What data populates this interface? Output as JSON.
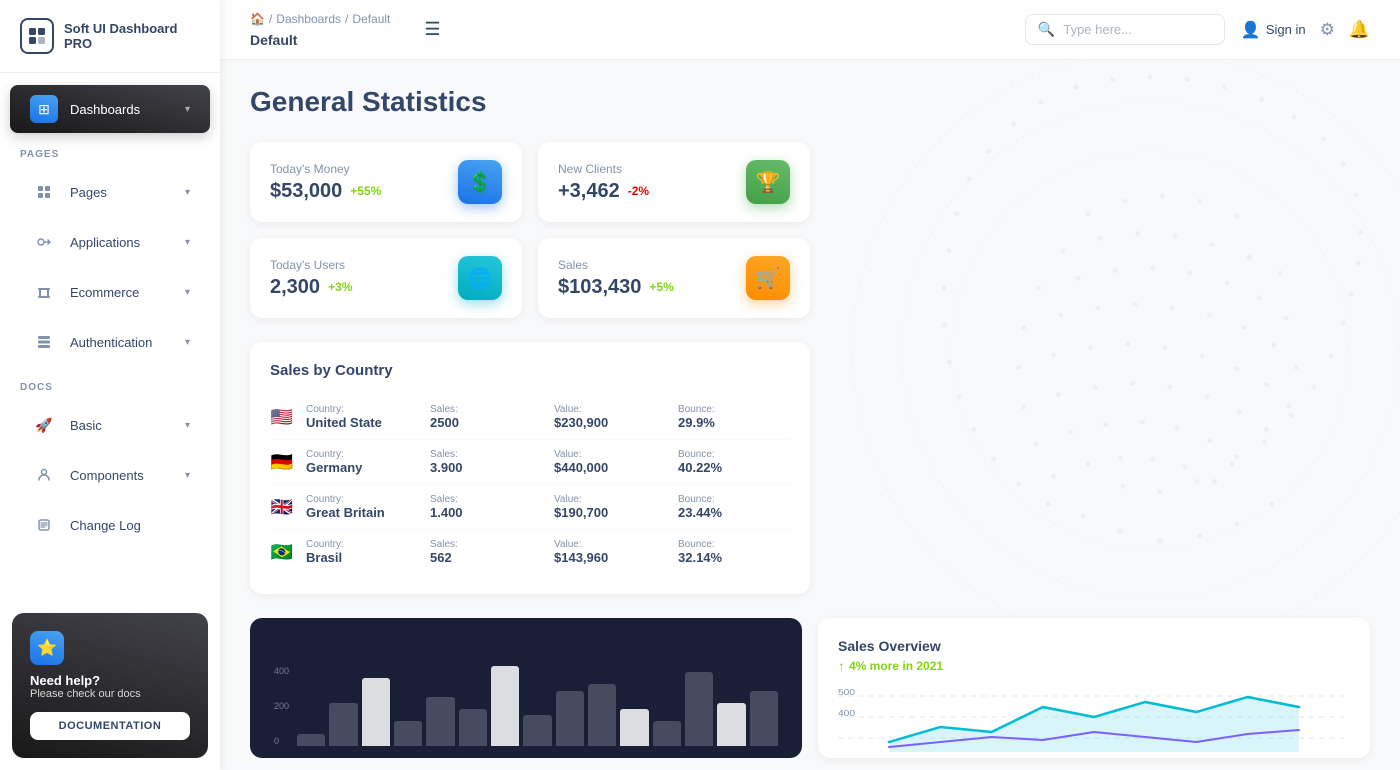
{
  "app": {
    "title": "Soft UI Dashboard PRO"
  },
  "sidebar": {
    "logo_text": "Soft UI Dashboard PRO",
    "active_item": "Dashboards",
    "sections": [
      {
        "label": "PAGES",
        "items": [
          {
            "id": "dashboards",
            "label": "Dashboards",
            "icon": "⊞",
            "active": true,
            "has_chevron": true
          },
          {
            "id": "pages",
            "label": "Pages",
            "icon": "📊",
            "active": false,
            "has_chevron": true
          },
          {
            "id": "applications",
            "label": "Applications",
            "icon": "🔧",
            "active": false,
            "has_chevron": true
          },
          {
            "id": "ecommerce",
            "label": "Ecommerce",
            "icon": "🏷️",
            "active": false,
            "has_chevron": true
          },
          {
            "id": "authentication",
            "label": "Authentication",
            "icon": "📄",
            "active": false,
            "has_chevron": true
          }
        ]
      },
      {
        "label": "DOCS",
        "items": [
          {
            "id": "basic",
            "label": "Basic",
            "icon": "🚀",
            "active": false,
            "has_chevron": true
          },
          {
            "id": "components",
            "label": "Components",
            "icon": "👤",
            "active": false,
            "has_chevron": true
          },
          {
            "id": "changelog",
            "label": "Change Log",
            "icon": "📋",
            "active": false,
            "has_chevron": false
          }
        ]
      }
    ],
    "help": {
      "title": "Need help?",
      "subtitle": "Please check our docs",
      "button_label": "DOCUMENTATION"
    }
  },
  "topbar": {
    "breadcrumb": {
      "home": "🏠",
      "separator1": "/",
      "dashboards": "Dashboards",
      "separator2": "/",
      "current": "Default"
    },
    "page_title": "Default",
    "menu_icon": "☰",
    "search_placeholder": "Type here...",
    "signin_label": "Sign in",
    "settings_icon": "⚙",
    "bell_icon": "🔔"
  },
  "main": {
    "page_title": "General Statistics",
    "stat_cards": [
      {
        "label": "Today's Money",
        "value": "$53,000",
        "change": "+55%",
        "change_type": "pos",
        "icon_type": "dollar"
      },
      {
        "label": "New Clients",
        "value": "+3,462",
        "change": "-2%",
        "change_type": "neg",
        "icon_type": "trophy"
      },
      {
        "label": "Today's Users",
        "value": "2,300",
        "change": "+3%",
        "change_type": "pos",
        "icon_type": "globe"
      },
      {
        "label": "Sales",
        "value": "$103,430",
        "change": "+5%",
        "change_type": "pos",
        "icon_type": "cart"
      }
    ],
    "sales_by_country": {
      "title": "Sales by Country",
      "columns": [
        "Country:",
        "Sales:",
        "Value:",
        "Bounce:"
      ],
      "rows": [
        {
          "flag": "🇺🇸",
          "country": "United State",
          "sales": "2500",
          "value": "$230,900",
          "bounce": "29.9%"
        },
        {
          "flag": "🇩🇪",
          "country": "Germany",
          "sales": "3.900",
          "value": "$440,000",
          "bounce": "40.22%"
        },
        {
          "flag": "🇬🇧",
          "country": "Great Britain",
          "sales": "1.400",
          "value": "$190,700",
          "bounce": "23.44%"
        },
        {
          "flag": "🇧🇷",
          "country": "Brasil",
          "sales": "562",
          "value": "$143,960",
          "bounce": "32.14%"
        }
      ]
    },
    "bar_chart": {
      "y_labels": [
        "400",
        "200",
        "0"
      ],
      "bars": [
        10,
        35,
        55,
        20,
        40,
        30,
        65,
        25,
        45,
        50,
        30,
        20,
        60,
        35,
        45
      ],
      "tall_indices": [
        2,
        6,
        10,
        13
      ]
    },
    "sales_overview": {
      "title": "Sales Overview",
      "change": "4% more in 2021",
      "y_labels": [
        "500",
        "400"
      ],
      "line_color": "#00BCD4"
    }
  }
}
